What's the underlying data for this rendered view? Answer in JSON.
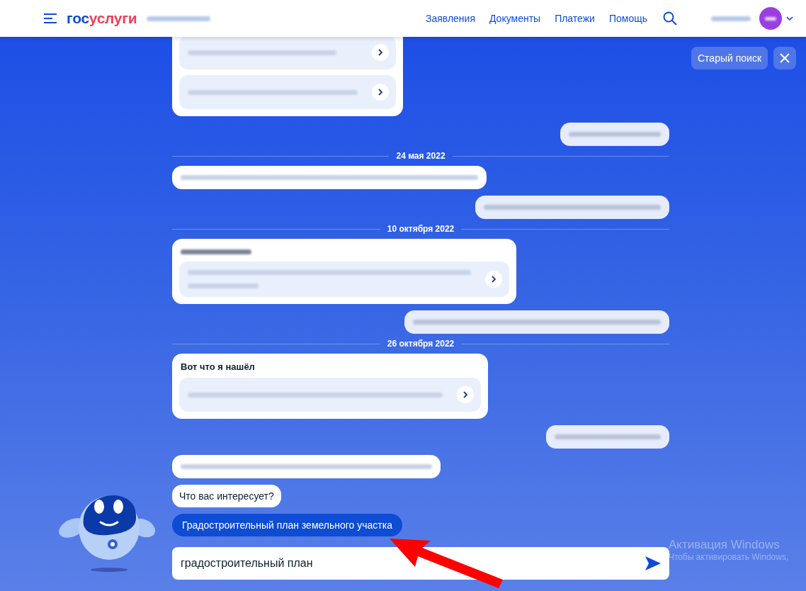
{
  "header": {
    "logo": [
      "гос",
      "услуги"
    ],
    "nav": [
      "Заявления",
      "Документы",
      "Платежи",
      "Помощь"
    ]
  },
  "top_actions": {
    "old_search": "Старый поиск"
  },
  "messages": [
    {
      "kind": "card",
      "items": [
        {
          "kind": "link"
        },
        {
          "kind": "link"
        }
      ]
    },
    {
      "kind": "blurred",
      "outgoing": true
    },
    {
      "kind": "date",
      "text": "24 мая 2022"
    },
    {
      "kind": "blurred",
      "outgoing": false
    },
    {
      "kind": "blurred",
      "outgoing": true
    },
    {
      "kind": "date",
      "text": "10 октября 2022"
    },
    {
      "kind": "card",
      "items": [
        {
          "kind": "link"
        }
      ]
    },
    {
      "kind": "blurred",
      "outgoing": true
    },
    {
      "kind": "date",
      "text": "26 октября 2022"
    },
    {
      "kind": "card",
      "title": "Вот что я нашёл",
      "items": [
        {
          "kind": "link"
        }
      ]
    },
    {
      "kind": "blurred",
      "outgoing": true
    },
    {
      "kind": "blurred",
      "outgoing": false
    },
    {
      "kind": "text",
      "text": "Что вас интересует?"
    },
    {
      "kind": "quick_reply",
      "text": "Градостроительный план земельного участка"
    }
  ],
  "input": {
    "value": "градостроительный план"
  },
  "os_overlay": {
    "title": "Активация Windows",
    "subtitle": "Чтобы активировать Windows,"
  }
}
